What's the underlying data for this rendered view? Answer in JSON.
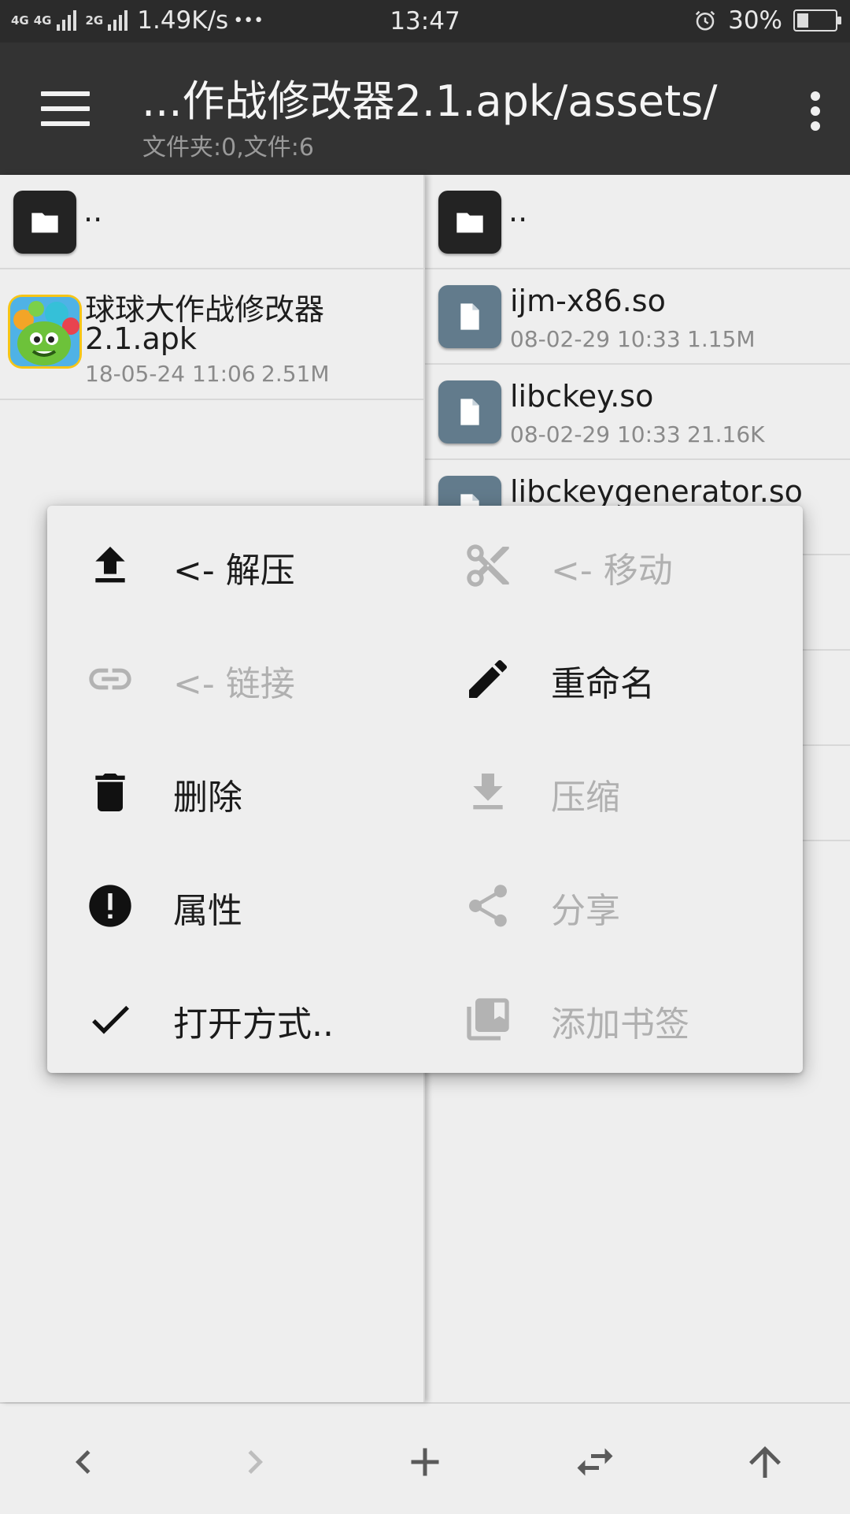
{
  "status_bar": {
    "network_1": "4G",
    "network_2": "4G",
    "network_3": "2G",
    "speed": "1.49K/s",
    "more": "•••",
    "time": "13:47",
    "battery": "30%",
    "battery_level": 0.3
  },
  "toolbar": {
    "title": "...作战修改器2.1.apk/assets/",
    "subtitle": "文件夹:0,文件:6"
  },
  "left_pane": {
    "up_label": "..",
    "items": [
      {
        "name_line1": "球球大作战修改器",
        "name_line2": "2.1.apk",
        "date": "18-05-24 11:06",
        "size": "2.51M",
        "icon": "app-icon"
      }
    ]
  },
  "right_pane": {
    "up_label": "..",
    "items": [
      {
        "name": "ijm-x86.so",
        "date": "08-02-29 10:33",
        "size": "1.15M",
        "icon": "file-icon"
      },
      {
        "name": "libckey.so",
        "date": "08-02-29 10:33",
        "size": "21.16K",
        "icon": "file-icon"
      },
      {
        "name": "libckeygenerator.so",
        "icon": "file-icon"
      }
    ]
  },
  "context_menu": {
    "items": [
      {
        "label": "<- 解压",
        "icon": "upload-icon",
        "enabled": true
      },
      {
        "label": "<- 移动",
        "icon": "scissors-icon",
        "enabled": false
      },
      {
        "label": "<- 链接",
        "icon": "link-icon",
        "enabled": false
      },
      {
        "label": "重命名",
        "icon": "pencil-icon",
        "enabled": true
      },
      {
        "label": "删除",
        "icon": "trash-icon",
        "enabled": true
      },
      {
        "label": "压缩",
        "icon": "download-icon",
        "enabled": false
      },
      {
        "label": "属性",
        "icon": "info-icon",
        "enabled": true
      },
      {
        "label": "分享",
        "icon": "share-icon",
        "enabled": false
      },
      {
        "label": "打开方式..",
        "icon": "check-icon",
        "enabled": true
      },
      {
        "label": "添加书签",
        "icon": "bookmark-icon",
        "enabled": false
      }
    ]
  },
  "bottom_nav": {
    "back": "chevron-left-icon",
    "forward": "chevron-right-icon",
    "add": "plus-icon",
    "swap": "swap-icon",
    "up": "arrow-up-icon"
  },
  "colors": {
    "toolbar": "#333333",
    "status_bar": "#2b2b2b",
    "file_icon_bg": "#627b8c",
    "folder_icon_bg": "#232323",
    "enabled_text": "#1b1b1b",
    "disabled_text": "#b0b0b0"
  }
}
